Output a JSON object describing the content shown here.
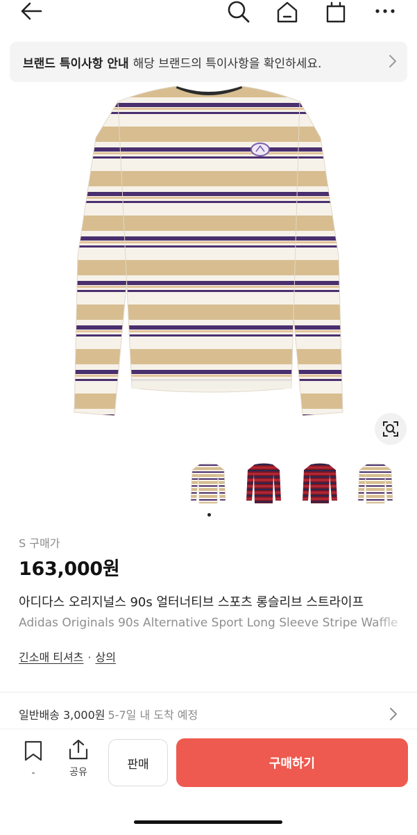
{
  "header": {
    "back_icon": "arrow-left-icon",
    "search_icon": "search-icon",
    "home_icon": "home-icon",
    "cart_icon": "shopping-bag-icon",
    "more_icon": "more-dots-icon"
  },
  "notice_banner": {
    "title": "브랜드 특이사항 안내",
    "text": "해당 브랜드의 특이사항을 확인하세요."
  },
  "gallery": {
    "thumbnails": [
      "beige-striped",
      "burgundy-striped",
      "burgundy-striped",
      "beige-striped"
    ],
    "active_index": 0
  },
  "product": {
    "size_label": "S 구매가",
    "price": "163,000원",
    "title_ko": "아디다스 오리지널스 90s 얼터너티브 스포츠 롱슬리브 스트라이프",
    "title_en": "Adidas Originals 90s Alternative Sport Long Sleeve Stripe Waffle",
    "category_main": "긴소매 티셔츠",
    "category_sub": "상의",
    "separator": "·"
  },
  "shipping": {
    "method": "일반배송 3,000원",
    "eta": "5-7일 내 도착 예정"
  },
  "bottom_bar": {
    "wish_count": "-",
    "share_label": "공유",
    "sell_label": "판매",
    "buy_label": "구매하기",
    "buy_color": "#ee5a4f"
  }
}
